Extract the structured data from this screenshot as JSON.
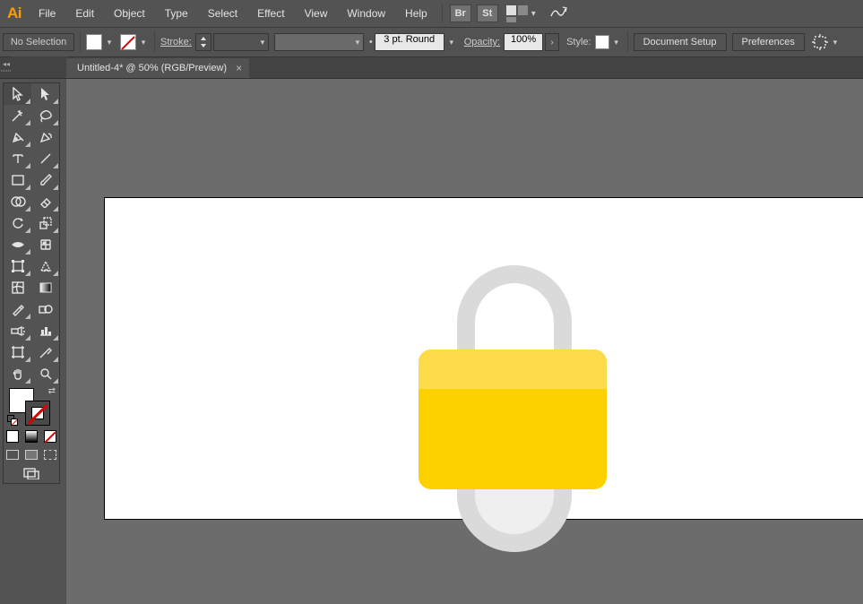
{
  "app": {
    "logo": "Ai"
  },
  "menu": {
    "items": [
      "File",
      "Edit",
      "Object",
      "Type",
      "Select",
      "Effect",
      "View",
      "Window",
      "Help"
    ],
    "launch": {
      "br": "Br",
      "st": "St"
    }
  },
  "control": {
    "selection": "No Selection",
    "stroke_label": "Stroke:",
    "brush_width": "3 pt. Round",
    "opacity_label": "Opacity:",
    "opacity_value": "100%",
    "style_label": "Style:",
    "doc_setup": "Document Setup",
    "preferences": "Preferences"
  },
  "tab": {
    "title": "Untitled-4* @ 50% (RGB/Preview)",
    "close": "×"
  },
  "tools": {
    "left": [
      "selection",
      "magic-wand",
      "pen",
      "type",
      "rectangle",
      "shape-builder",
      "rotate",
      "width",
      "free-transform",
      "mesh",
      "eyedropper",
      "symbol-sprayer",
      "artboard",
      "hand"
    ],
    "right": [
      "direct-selection",
      "lasso",
      "curvature",
      "line",
      "paintbrush",
      "eraser",
      "scale",
      "puppet-warp",
      "shaper",
      "gradient",
      "blend",
      "column-graph",
      "slice",
      "zoom"
    ]
  }
}
